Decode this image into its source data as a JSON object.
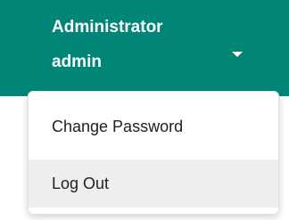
{
  "user_menu": {
    "display_name": "Administrator",
    "username": "admin",
    "caret_icon": "caret-down-icon"
  },
  "dropdown": {
    "items": [
      {
        "label": "Change Password",
        "highlighted": false
      },
      {
        "label": "Log Out",
        "highlighted": true
      }
    ]
  },
  "colors": {
    "header_bg": "#008577",
    "header_text": "#ffffff",
    "menu_bg": "#ffffff",
    "menu_hover_bg": "#eeeeee",
    "menu_text": "#212121"
  }
}
